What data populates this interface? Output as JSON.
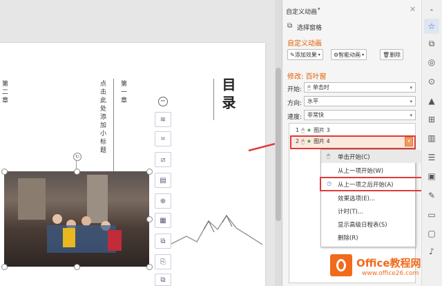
{
  "slide": {
    "col_left": "第二章",
    "col_mid": "点击此处添加小标题",
    "col_mid2": "第一章",
    "title": "目录"
  },
  "panel": {
    "title": "自定义动画",
    "selection_pane": "选择窗格",
    "section_title": "自定义动画",
    "add_effect": "添加效果",
    "smart_anim": "智能动画",
    "delete": "删除",
    "modify_label": "修改: 百叶窗",
    "start_label": "开始:",
    "start_value": "单击时",
    "direction_label": "方向:",
    "direction_value": "水平",
    "speed_label": "速度:",
    "speed_value": "非常快",
    "list": [
      {
        "num": "1",
        "name": "图片 3"
      },
      {
        "num": "2",
        "name": "图片 4"
      }
    ],
    "menu": [
      "单击开始(C)",
      "从上一项开始(W)",
      "从上一项之后开始(A)",
      "效果选项(E)...",
      "计时(T)...",
      "显示高级日程表(S)",
      "删除(R)"
    ]
  },
  "watermark": {
    "brand": "Office教程网",
    "url": "www.office26.com"
  },
  "colors": {
    "accent_orange": "#e35d00",
    "highlight_red": "#e03a3a",
    "watermark_orange": "#f26a1b"
  }
}
